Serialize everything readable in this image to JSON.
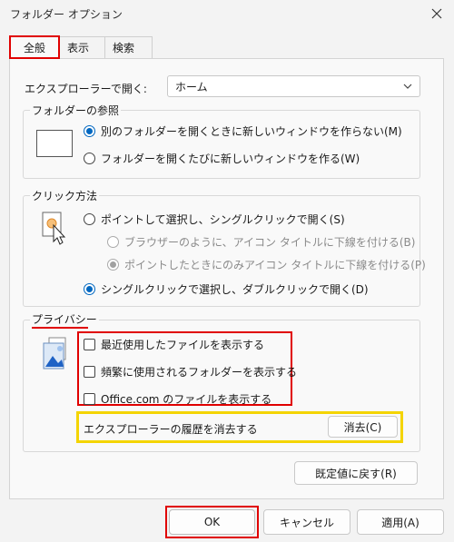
{
  "window": {
    "title": "フォルダー オプション"
  },
  "tabs": [
    {
      "label": "全般"
    },
    {
      "label": "表示"
    },
    {
      "label": "検索"
    }
  ],
  "general": {
    "open_explorer_label": "エクスプローラーで開く:",
    "open_explorer_value": "ホーム",
    "browse_folders": {
      "title": "フォルダーの参照",
      "options": [
        "別のフォルダーを開くときに新しいウィンドウを作らない(M)",
        "フォルダーを開くたびに新しいウィンドウを作る(W)"
      ],
      "selected_index": 0
    },
    "click_items": {
      "title": "クリック方法",
      "single_click": "ポイントして選択し、シングルクリックで開く(S)",
      "underline_browser": "ブラウザーのように、アイコン タイトルに下線を付ける(B)",
      "underline_point": "ポイントしたときにのみアイコン タイトルに下線を付ける(P)",
      "double_click": "シングルクリックで選択し、ダブルクリックで開く(D)"
    },
    "privacy": {
      "title": "プライバシー",
      "checkboxes": [
        "最近使用したファイルを表示する",
        "頻繁に使用されるフォルダーを表示する",
        "Office.com のファイルを表示する"
      ],
      "clear_history_label": "エクスプローラーの履歴を消去する",
      "clear_button": "消去(C)"
    },
    "restore_defaults": "既定値に戻す(R)"
  },
  "footer": {
    "ok": "OK",
    "cancel": "キャンセル",
    "apply": "適用(A)"
  },
  "colors": {
    "accent": "#0067c0",
    "highlight_red": "#e00000",
    "highlight_yellow": "#f4d400"
  }
}
